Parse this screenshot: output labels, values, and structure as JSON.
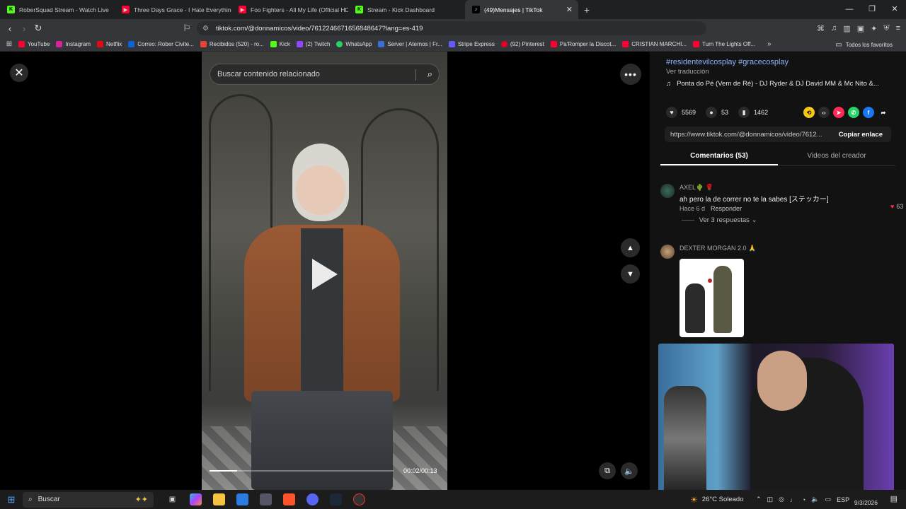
{
  "browser": {
    "tabs": [
      {
        "label": "RoberSquad Stream - Watch Live",
        "favicon_color": "#53fc18"
      },
      {
        "label": "Three Days Grace - I Hate Everything",
        "favicon_color": "#ff0033"
      },
      {
        "label": "Foo Fighters - All My Life (Official HD",
        "favicon_color": "#ff0033"
      },
      {
        "label": "Stream - Kick Dashboard",
        "favicon_color": "#53fc18"
      },
      {
        "label": "(49)Mensajes | TikTok",
        "favicon_color": "#ffffff"
      }
    ],
    "url": "tiktok.com/@donnamicos/video/7612246671656848647?lang=es-419",
    "bookmarks": [
      {
        "label": "YouTube",
        "color": "#ff0033"
      },
      {
        "label": "Instagram",
        "color": "#d6249f"
      },
      {
        "label": "Netflix",
        "color": "#e50914"
      },
      {
        "label": "Correo: Rober Civite...",
        "color": "#0a64d6"
      },
      {
        "label": "Recibidos (520) - ro...",
        "color": "#ea4335"
      },
      {
        "label": "Kick",
        "color": "#53fc18"
      },
      {
        "label": "(2) Twitch",
        "color": "#9146ff"
      },
      {
        "label": "WhatsApp",
        "color": "#25d366"
      },
      {
        "label": "Server | Aternos | Fr...",
        "color": "#3c6fd1"
      },
      {
        "label": "Stripe Express",
        "color": "#635bff"
      },
      {
        "label": "(92) Pinterest",
        "color": "#e60023"
      },
      {
        "label": "Pa'Romper la Discot...",
        "color": "#ff0033"
      },
      {
        "label": "CRISTIAN MARCHI...",
        "color": "#ff0033"
      },
      {
        "label": "Turn The Lights Off...",
        "color": "#ff0033"
      }
    ],
    "all_bookmarks": "Todos los favoritos"
  },
  "viewer": {
    "search_placeholder": "Buscar contenido relacionado",
    "timecode": "00:02/00:13",
    "progress_fraction": 0.15
  },
  "panel": {
    "hashtags": "#residentevilcosplay #gracecosplay",
    "translate": "Ver traducción",
    "music": "Ponta do Pé (Vem de Ré) - DJ Ryder & DJ David MM & Mc Nito &...",
    "likes": "5569",
    "comments_count": "53",
    "saves": "1462",
    "link": "https://www.tiktok.com/@donnamicos/video/7612...",
    "copy_link": "Copiar enlace",
    "tab_comments": "Comentarios (53)",
    "tab_creator": "Videos del creador",
    "comments": [
      {
        "user": "AXEL🌵 🌹",
        "text": "ah pero la de correr no te la sabes [ステッカー]",
        "time": "Hace 6 d",
        "reply": "Responder",
        "likes": "63",
        "replies": "Ver 3 respuestas"
      },
      {
        "user": "DEXTER MORGAN 2.0 🙏"
      }
    ]
  },
  "taskbar": {
    "search": "Buscar",
    "weather": "26°C Soleado",
    "lang": "ESP",
    "date": "9/3/2026"
  }
}
